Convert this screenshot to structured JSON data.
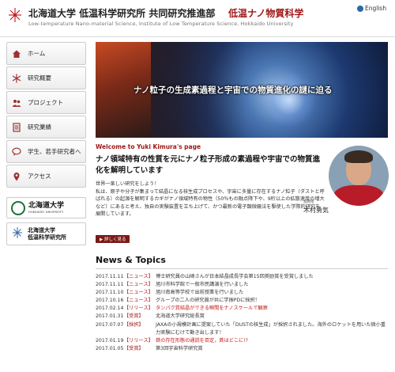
{
  "header": {
    "university_name": "北海道大学 低温科学研究所 共同研究推進部",
    "section_title": "低温ナノ物質科学",
    "subtitle": "Low-temperature Nano-material Science, Institute of Low Temperature Science, Hokkaido University",
    "language_link": "English"
  },
  "sidebar": {
    "items": [
      {
        "label": "ホーム",
        "icon": "home-icon"
      },
      {
        "label": "研究概要",
        "icon": "snowflake-icon"
      },
      {
        "label": "プロジェクト",
        "icon": "group-icon"
      },
      {
        "label": "研究業績",
        "icon": "document-icon"
      },
      {
        "label": "学生、若手研究者へ",
        "icon": "chat-bubble-icon"
      },
      {
        "label": "アクセス",
        "icon": "map-pin-icon"
      }
    ],
    "banners": {
      "hokkaido": {
        "title": "北海道大学",
        "subtitle": "HOKKAIDO UNIVERSITY"
      },
      "ilts": {
        "line1": "北海道大学",
        "line2": "低温科学研究所"
      }
    }
  },
  "hero": {
    "caption": "ナノ粒子の生成素過程と宇宙での物質進化の謎に迫る"
  },
  "welcome": {
    "heading": "Welcome to Yuki Kimura's page",
    "headline": "ナノ領域特有の性質を元にナノ粒子形成の素過程や宇宙での物質進化を解明しています",
    "body": [
      "世界一楽しい研究をしよう！",
      "私は、原子や分子が集まって結晶になる核生成プロセスや、宇宙に多量に存在するナノ粒子（ダストと呼ばれる）の起源を解明するカギがナノ領域特有の物性（50％もの融点降下や、9桁以上の拡散速度の増大など）にあると考え、独自の実験装置を立ち上げて、かつ最新の電子顕微鏡法を駆使した学際的研究を展開しています。"
    ],
    "more_button": "▶ 詳しく見る",
    "person": {
      "role": "准教授",
      "name": "木村勇気"
    }
  },
  "news": {
    "title": "News & Topics",
    "items": [
      {
        "date": "2017.11.11",
        "category": "【ニュース】",
        "text": "博士研究員の山崎さんが日本結晶成長学会第15回奨励賞を受賞しました",
        "highlight": false
      },
      {
        "date": "2017.11.11",
        "category": "【ニュース】",
        "text": "旭川市科学館で一般市民講演を行いました",
        "highlight": false
      },
      {
        "date": "2017.11.10",
        "category": "【ニュース】",
        "text": "旭川南高等学校で出前授業を行いました",
        "highlight": false
      },
      {
        "date": "2017.10.16",
        "category": "【ニュース】",
        "text": "グループの二人の研究員が共に学振PDに採択！",
        "highlight": false
      },
      {
        "date": "2017.02.14",
        "category": "【リリース】",
        "text": "タンパク質結晶ができる瞬間をナノスケールで観察",
        "highlight": true
      },
      {
        "date": "2017.01.31",
        "category": "【受賞】",
        "text": "北海道大学研究総長賞",
        "highlight": false
      },
      {
        "date": "2017.07.07",
        "category": "【採択】",
        "text": "JAXAの小規模計画に提案していた「DUSTの核生成」が採択されました。海外のロケットを用いた微小重力実験にむけて動き出します！",
        "highlight": false
      },
      {
        "date": "2017.01.19",
        "category": "【リリース】",
        "text": "鉄の存在形態の通説を否定，鉄はどこに!?",
        "highlight": true
      },
      {
        "date": "2017.01.05",
        "category": "【受賞】",
        "text": "第3回宇宙科学研究賞",
        "highlight": false
      }
    ]
  },
  "colors": {
    "accent": "#a01818",
    "button": "#7a1a18"
  }
}
